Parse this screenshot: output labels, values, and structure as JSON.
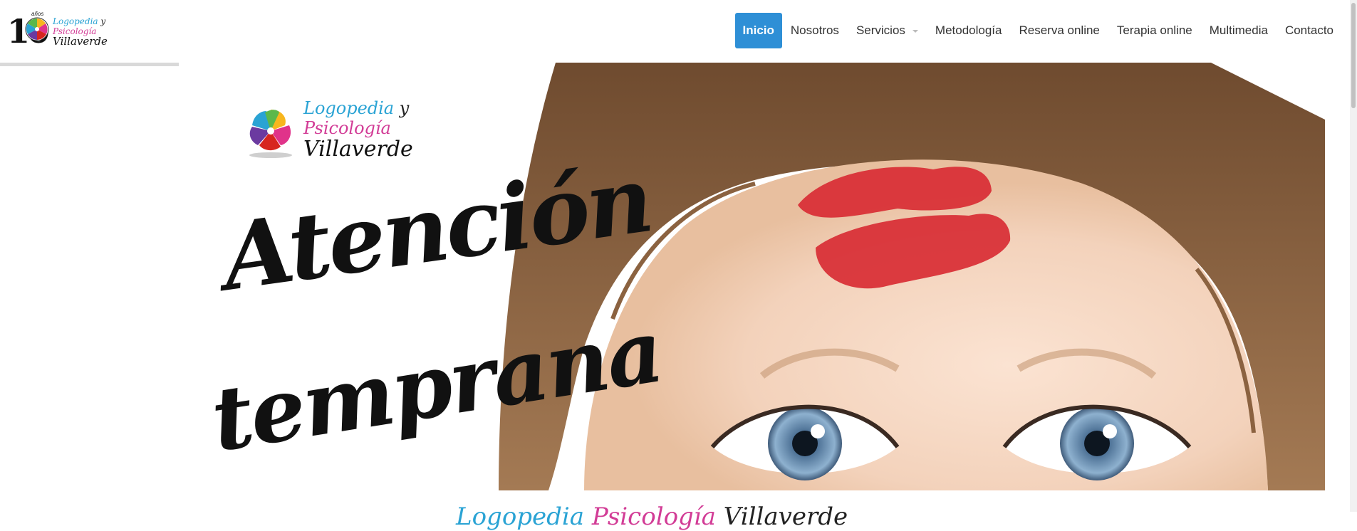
{
  "header": {
    "logo": {
      "ten": "10",
      "anos": "años",
      "line1": "Logopedia",
      "line1_y": "y",
      "line2": "Psicología",
      "line3": "Villaverde"
    },
    "nav": [
      {
        "label": "Inicio",
        "active": true
      },
      {
        "label": "Nosotros"
      },
      {
        "label": "Servicios",
        "dropdown": true
      },
      {
        "label": "Metodología"
      },
      {
        "label": "Reserva online"
      },
      {
        "label": "Terapia online"
      },
      {
        "label": "Multimedia"
      },
      {
        "label": "Contacto"
      }
    ]
  },
  "hero": {
    "logo": {
      "line1": "Logopedia",
      "line1_y": "y",
      "line2": "Psicología",
      "line3": "Villaverde"
    },
    "title_line1": "Atención",
    "title_line2": "temprana"
  },
  "bottom": {
    "part1": "Logopedia",
    "part2": "Psicología",
    "part3": "Villaverde"
  },
  "colors": {
    "accent": "#2e8fd6",
    "brand_blue": "#2aa3d4",
    "brand_pink": "#d23c96",
    "lip_red": "#d82c34"
  }
}
